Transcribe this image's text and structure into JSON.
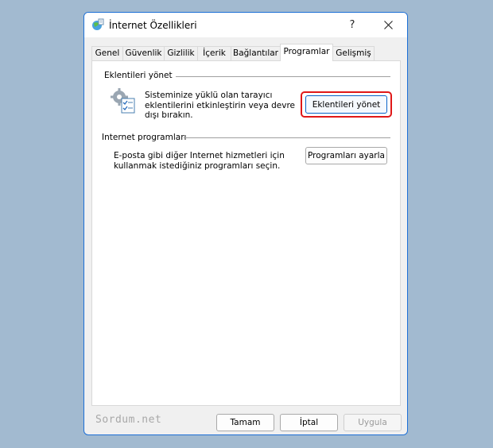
{
  "window": {
    "title": "İnternet Özellikleri",
    "help_label": "?",
    "accent_color": "#1c6fd6"
  },
  "tabs": [
    {
      "label": "Genel"
    },
    {
      "label": "Güvenlik"
    },
    {
      "label": "Gizlilik"
    },
    {
      "label": "İçerik"
    },
    {
      "label": "Bağlantılar"
    },
    {
      "label": "Programlar",
      "active": true
    },
    {
      "label": "Gelişmiş"
    }
  ],
  "addons": {
    "group_label": "Eklentileri yönet",
    "description": "Sisteminize yüklü olan tarayıcı eklentilerini etkinleştirin veya devre dışı bırakın.",
    "button_label": "Eklentileri yönet",
    "icon": "gears-checklist-icon",
    "highlight_color": "#e01818"
  },
  "internet_programs": {
    "group_label": "Internet programları",
    "description": "E-posta gibi diğer Internet hizmetleri için kullanmak istediğiniz programları seçin.",
    "button_label": "Programları ayarla"
  },
  "footer": {
    "watermark": "Sordum.net",
    "ok_label": "Tamam",
    "cancel_label": "İptal",
    "apply_label": "Uygula"
  }
}
